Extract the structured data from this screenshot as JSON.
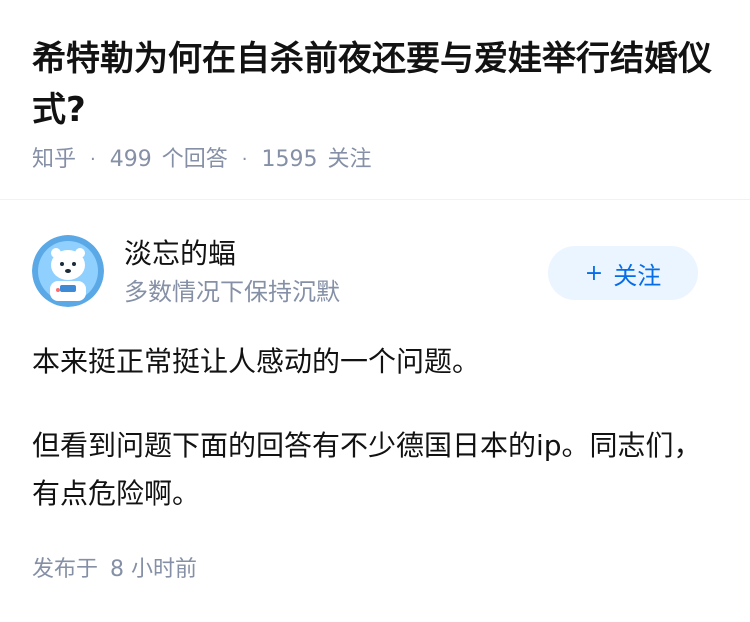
{
  "question": {
    "title": "希特勒为何在自杀前夜还要与爱娃举行结婚仪式?",
    "source": "知乎",
    "answer_count": "499",
    "answer_unit": "个回答",
    "follower_count": "1595",
    "follower_unit": "关注"
  },
  "author": {
    "name": "淡忘的蝠",
    "bio": "多数情况下保持沉默",
    "avatar_icon": "polar-bear-astronaut-avatar"
  },
  "follow_button": {
    "label": "关注",
    "icon": "plus-icon"
  },
  "answer": {
    "paragraphs": [
      "本来挺正常挺让人感动的一个问题。",
      "但看到问题下面的回答有不少德国日本的ip。同志们，有点危险啊。"
    ]
  },
  "post_time": {
    "prefix": "发布于",
    "value": "8 小时前"
  },
  "colors": {
    "text": "#121212",
    "meta": "#8590a6",
    "accent": "#056de8",
    "button_bg": "#ebf5ff"
  }
}
